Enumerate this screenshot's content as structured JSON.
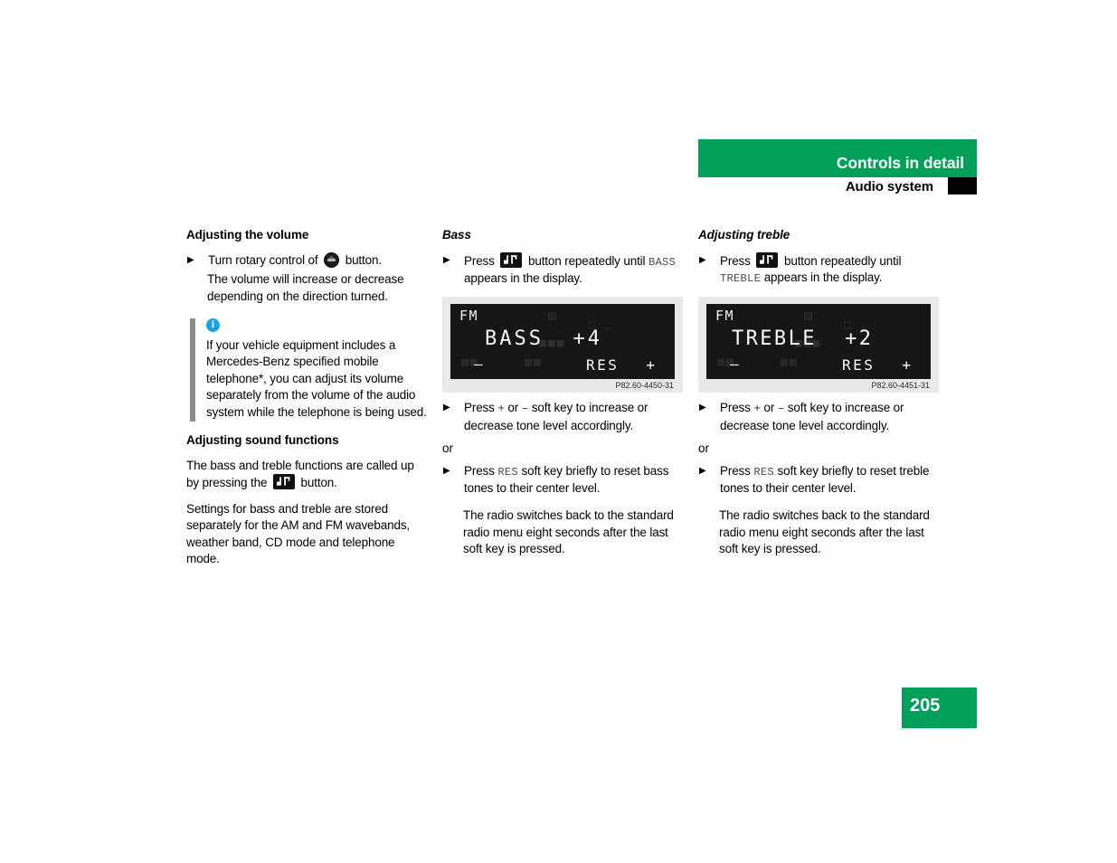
{
  "header": {
    "chapter_title": "Controls in detail",
    "section_title": "Audio system",
    "accent_color": "#00a05a",
    "tab_color": "#000000"
  },
  "page_number": "205",
  "columns": {
    "left": {
      "heading_volume": "Adjusting the volume",
      "step_volume_pre": "Turn rotary control of",
      "step_volume_post": "button.",
      "volume_result": "The volume will increase or decrease depending on the direction turned.",
      "note": {
        "icon": "info-icon",
        "text": "If your vehicle equipment includes a Mercedes-Benz specified mobile telephone*, you can adjust its volume separately from the volume of the audio system while the telephone is being used."
      },
      "heading_sound": "Adjusting sound functions",
      "sound_para_pre": "The bass and treble functions are called up by pressing the",
      "sound_para_post": "button.",
      "sound_para_2": "Settings for bass and treble are stored separately for the AM and FM wavebands, weather band, CD mode and telephone mode."
    },
    "middle": {
      "heading": "Bass",
      "step_press_pre": "Press",
      "step_press_mid": "button repeatedly until",
      "step_press_token": "BASS",
      "step_press_post": "appears in the display.",
      "figure": {
        "band": "FM",
        "main": "BASS  +4",
        "minus": "–",
        "res": "RES",
        "plus": "+",
        "caption": "P82.60-4450-31"
      },
      "step_softkey_pre": "Press",
      "step_softkey_plus": "+",
      "step_softkey_or": "or",
      "step_softkey_minus": "–",
      "step_softkey_post": "soft key to increase or decrease tone level accordingly.",
      "or_label": "or",
      "step_res_pre": "Press",
      "step_res_token": "RES",
      "step_res_post": "soft key briefly to reset bass tones to their center level.",
      "timeout_note": "The radio switches back to the standard radio menu eight seconds after the last soft key is pressed."
    },
    "right": {
      "heading": "Adjusting treble",
      "step_press_pre": "Press",
      "step_press_mid": "button repeatedly until",
      "step_press_token": "TREBLE",
      "step_press_post": "appears in the display.",
      "figure": {
        "band": "FM",
        "main": "TREBLE  +2",
        "minus": "–",
        "res": "RES",
        "plus": "+",
        "caption": "P82.60-4451-31"
      },
      "step_softkey_pre": "Press",
      "step_softkey_plus": "+",
      "step_softkey_or": "or",
      "step_softkey_minus": "–",
      "step_softkey_post": "soft key to increase or decrease tone level accordingly.",
      "or_label": "or",
      "step_res_pre": "Press",
      "step_res_token": "RES",
      "step_res_post": "soft key briefly to reset treble tones to their center level.",
      "timeout_note": "The radio switches back to the standard radio menu eight seconds after the last soft key is pressed."
    }
  },
  "icons": {
    "sound_button": "music-note-button-icon",
    "rotary_knob": "rotary-knob-icon",
    "bullet": "▶"
  }
}
